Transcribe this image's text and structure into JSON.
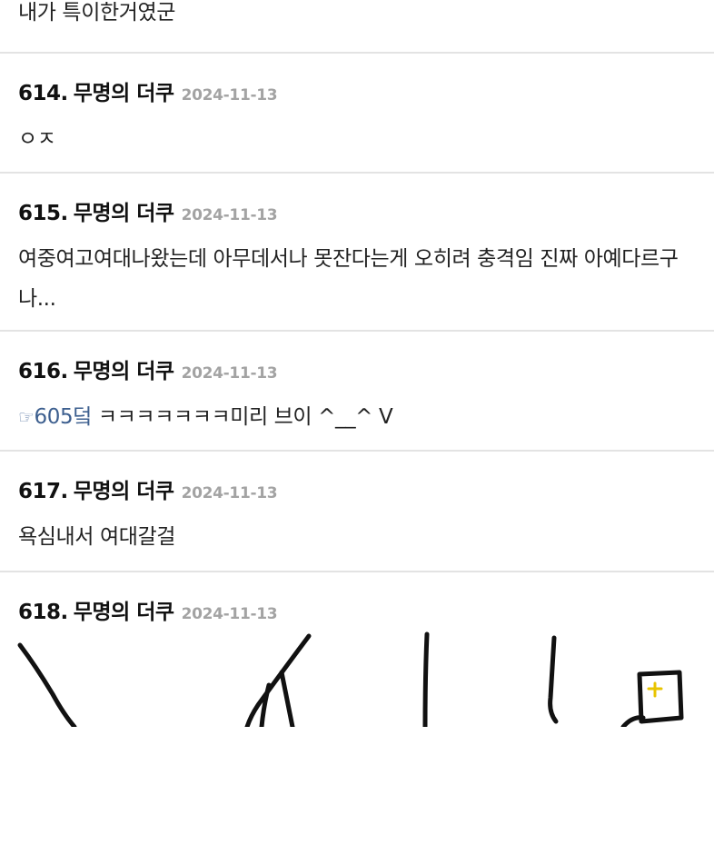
{
  "thread": {
    "top_post": {
      "body": "내가 특이한거였군"
    },
    "posts": [
      {
        "number": "614.",
        "author": "무명의 더쿠",
        "date": "2024-11-13",
        "body": "ㅇㅈ"
      },
      {
        "number": "615.",
        "author": "무명의 더쿠",
        "date": "2024-11-13",
        "body": "여중여고여대나왔는데 아무데서나 못잔다는게 오히려 충격임 진짜 아예다르구나..."
      },
      {
        "number": "616.",
        "author": "무명의 더쿠",
        "date": "2024-11-13",
        "reply_icon": "pointing-hand-icon",
        "reply_glyph": "☞",
        "reply_link": "605덬",
        "body": " ㅋㅋㅋㅋㅋㅋㅋ미리 브이 ^__^ V"
      },
      {
        "number": "617.",
        "author": "무명의 더쿠",
        "date": "2024-11-13",
        "body": "욕심내서 여대갈걸"
      },
      {
        "number": "618.",
        "author": "무명의 더쿠",
        "date": "2024-11-13",
        "attachment": "hand-drawn-image"
      }
    ]
  },
  "colors": {
    "date": "#a3a3a3",
    "link": "#3d5f8f",
    "divider": "#e3e3e3",
    "text": "#222222"
  }
}
